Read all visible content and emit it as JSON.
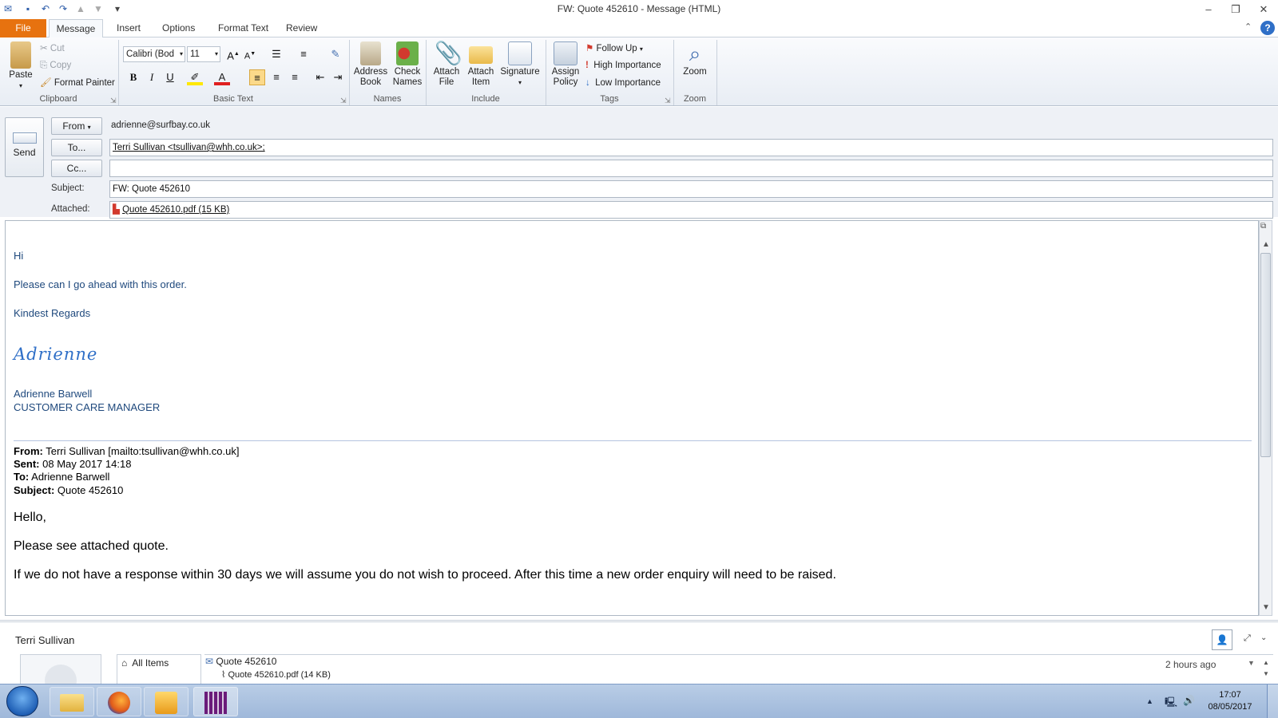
{
  "window": {
    "title": "FW: Quote 452610  -  Message (HTML)"
  },
  "tabs": [
    {
      "label": "File"
    },
    {
      "label": "Message"
    },
    {
      "label": "Insert"
    },
    {
      "label": "Options"
    },
    {
      "label": "Format Text"
    },
    {
      "label": "Review"
    }
  ],
  "ribbon": {
    "clipboard": {
      "label": "Clipboard",
      "paste": "Paste",
      "cut": "Cut",
      "copy": "Copy",
      "format_painter": "Format Painter"
    },
    "basic_text": {
      "label": "Basic Text",
      "font": "Calibri (Bod",
      "size": "11",
      "bold": "B",
      "italic": "I",
      "underline": "U"
    },
    "names": {
      "label": "Names",
      "address_book": "Address Book",
      "check_names": "Check Names"
    },
    "include": {
      "label": "Include",
      "attach_file": "Attach File",
      "attach_item": "Attach Item",
      "signature": "Signature"
    },
    "tags": {
      "label": "Tags",
      "assign_policy": "Assign Policy",
      "follow_up": "Follow Up",
      "high_importance": "High Importance",
      "low_importance": "Low Importance"
    },
    "zoom": {
      "label": "Zoom",
      "zoom": "Zoom"
    }
  },
  "header": {
    "send": "Send",
    "from_button": "From",
    "from_value": "adrienne@surfbay.co.uk",
    "to_button": "To...",
    "to_value": "Terri Sullivan <tsullivan@whh.co.uk>;",
    "cc_button": "Cc...",
    "cc_value": "",
    "subject_label": "Subject:",
    "subject_value": "FW: Quote 452610",
    "attached_label": "Attached:",
    "attachment": "Quote 452610.pdf (15 KB)"
  },
  "body": {
    "greeting": "Hi",
    "line1": "Please can I go ahead with this order.",
    "closing": "Kindest Regards",
    "signature_script": "Adrienne",
    "sig_name": "Adrienne Barwell",
    "sig_title": "CUSTOMER CARE MANAGER",
    "fwd_from_label": "From:",
    "fwd_from": "Terri Sullivan [mailto:tsullivan@whh.co.uk]",
    "fwd_sent_label": "Sent:",
    "fwd_sent": "08 May 2017 14:18",
    "fwd_to_label": "To:",
    "fwd_to": "Adrienne Barwell",
    "fwd_subject_label": "Subject:",
    "fwd_subject": "Quote 452610",
    "q_hello": "Hello,",
    "q_line1": "Please see attached quote.",
    "q_line2": "If we do not have a response within 30 days we will assume you do not wish to proceed. After this time a new order enquiry will need to be raised."
  },
  "people_pane": {
    "name": "Terri Sullivan",
    "all_items": "All Items",
    "item_title": "Quote 452610",
    "item_attachment": "Quote 452610.pdf (14 KB)",
    "item_time": "2 hours ago"
  },
  "taskbar": {
    "time": "17:07",
    "date": "08/05/2017"
  }
}
